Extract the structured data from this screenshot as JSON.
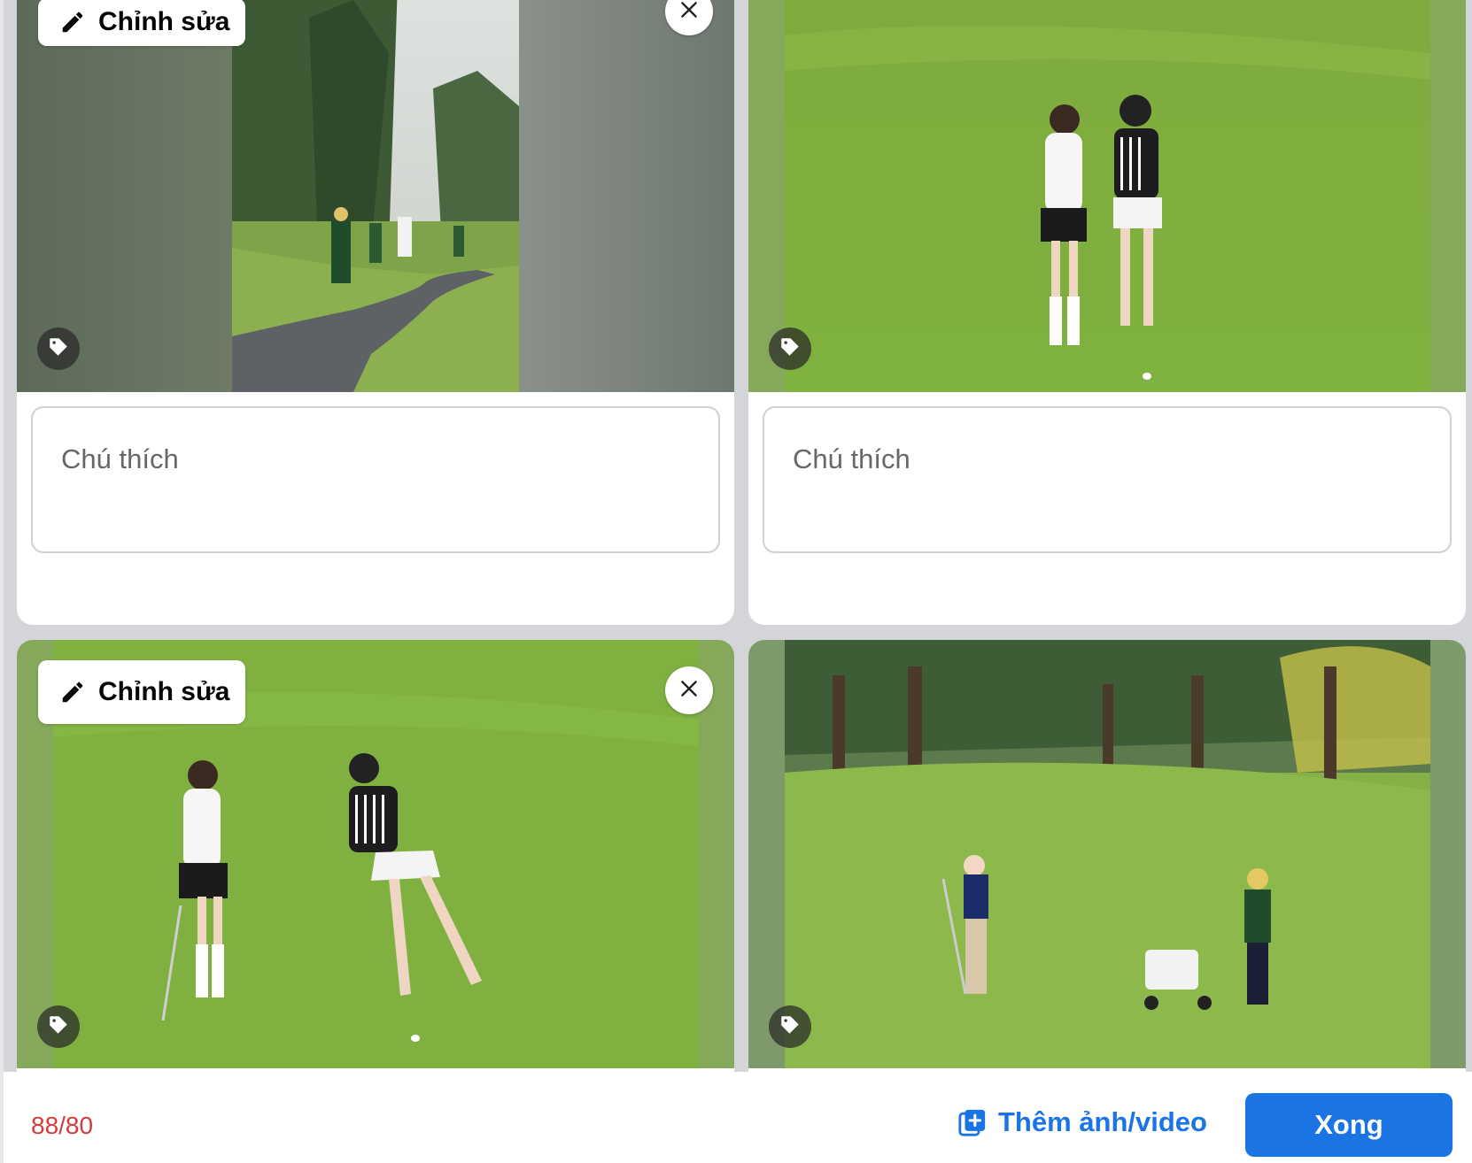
{
  "cards": [
    {
      "id": "photo-1",
      "caption_placeholder": "Chú thích",
      "edit_label": "Chỉnh sửa"
    },
    {
      "id": "photo-2",
      "caption_placeholder": "Chú thích"
    },
    {
      "id": "photo-3",
      "edit_label": "Chỉnh sửa"
    },
    {
      "id": "photo-4"
    }
  ],
  "footer": {
    "counter": "88/80",
    "add_media_label": "Thêm ảnh/video",
    "done_label": "Xong"
  },
  "icons": {
    "edit": "pencil-icon",
    "close": "close-icon",
    "tag": "tag-icon",
    "add_media": "add-photo-icon"
  },
  "colors": {
    "accent": "#1b74e4",
    "counter_over_limit": "#d33c3c",
    "background": "#d4d5d8"
  }
}
